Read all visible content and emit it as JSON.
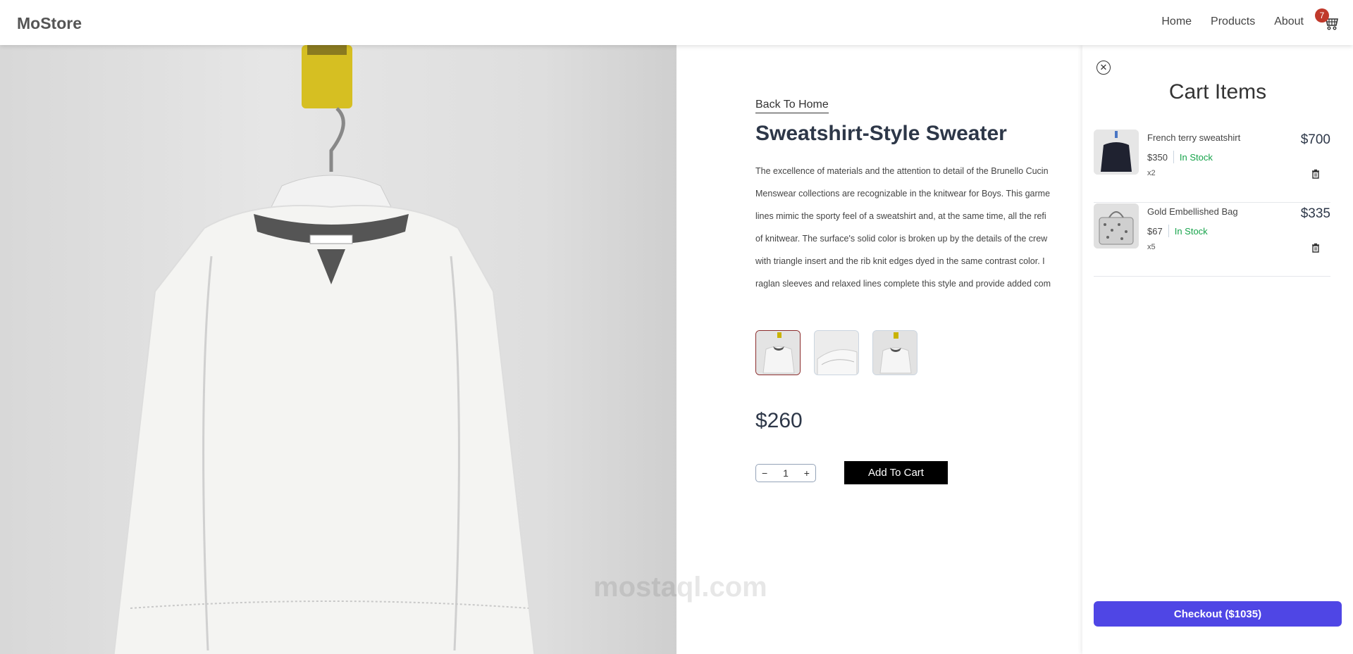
{
  "brand": "MoStore",
  "nav": {
    "items": [
      "Home",
      "Products",
      "About"
    ],
    "cart_count": "7"
  },
  "product": {
    "back_label": "Back To Home",
    "title": "Sweatshirt-Style Sweater",
    "description_lines": [
      "The excellence of materials and the attention to detail of the Brunello Cucin",
      "Menswear collections are recognizable in the knitwear for Boys. This garme",
      "lines mimic the sporty feel of a sweatshirt and, at the same time, all the refi",
      "of knitwear. The surface's solid color is broken up by the details of the crew",
      "with triangle insert and the rib knit edges dyed in the same contrast color. I",
      "raglan sleeves and relaxed lines complete this style and provide added com"
    ],
    "price": "$260",
    "quantity": "1",
    "add_to_cart_label": "Add To Cart"
  },
  "cart": {
    "title": "Cart Items",
    "items": [
      {
        "name": "French terry sweatshirt",
        "unit_price": "$350",
        "stock": "In Stock",
        "qty": "x2",
        "total": "$700"
      },
      {
        "name": "Gold Embellished Bag",
        "unit_price": "$67",
        "stock": "In Stock",
        "qty": "x5",
        "total": "$335"
      }
    ],
    "checkout_label": "Checkout ($1035)"
  },
  "watermark": "mostaql.com",
  "colors": {
    "accent": "#4f46e5",
    "badge": "#c0392b",
    "stock": "#16a34a",
    "active_thumb": "#8b2b2b"
  }
}
